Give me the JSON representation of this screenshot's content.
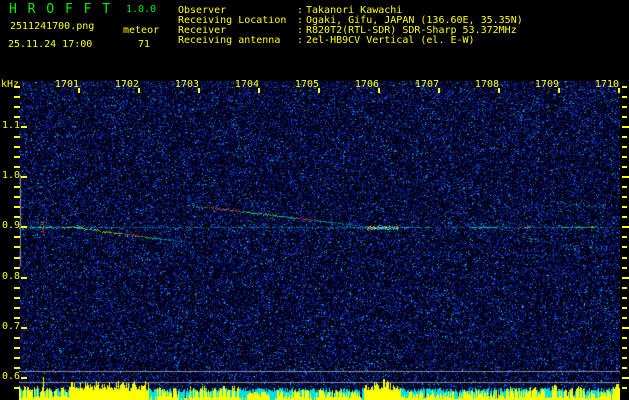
{
  "app": {
    "title": "H R O F F T",
    "version": "1.0.0",
    "filename": "2511241700.png",
    "mode": "meteor",
    "timestamp": "25.11.24 17:00",
    "echo_count": "71"
  },
  "station": {
    "colon": ":",
    "rows": [
      {
        "label": "Observer",
        "value": "Takanori Kawachi"
      },
      {
        "label": "Receiving Location",
        "value": "Ogaki, Gifu, JAPAN (136.60E, 35.35N)"
      },
      {
        "label": "Receiver",
        "value": "R820T2(RTL-SDR) SDR-Sharp 53.372MHz"
      },
      {
        "label": "Receiving antenna",
        "value": "2el-HB9CV Vertical (el. E-W)"
      }
    ]
  },
  "colors": {
    "text_yellow": "#ffff00",
    "text_green": "#00ee00",
    "noise_blue": "#2233cc",
    "carrier_cyan": "#00c8ff",
    "strong_echo_red": "#ff2400",
    "signal_bar_yellow": "#ffff00",
    "signal_floor_cyan": "#00e0e0",
    "marker_gray": "#a8a8b8"
  },
  "chart_data": {
    "type": "heatmap",
    "subtype": "radio-meteor-spectrogram",
    "freq_axis": {
      "unit": "kHz",
      "tick_labels": [
        "1.1",
        "1.0",
        "0.9",
        "0.8",
        "0.7",
        "0.6"
      ],
      "minor_step_khz": 0.02,
      "range_khz": [
        0.58,
        1.19
      ]
    },
    "time_axis": {
      "tick_labels": [
        "1701",
        "1702",
        "1703",
        "1704",
        "1705",
        "1706",
        "1707",
        "1708",
        "1709",
        "1710"
      ],
      "start_hhmm": "17:00",
      "span_minutes": 10
    },
    "carrier_freq_khz": 0.9,
    "echoes": [
      {
        "kind": "carrier",
        "f": 0.9
      },
      {
        "kind": "segment",
        "f": 0.9,
        "t0": 0.0,
        "t1": 1.05,
        "palette": [
          "#22ff88",
          "#aaff22",
          "#00ffcc",
          "#55ff44"
        ]
      },
      {
        "kind": "ping",
        "t": 0.4,
        "f0": 0.888,
        "f1": 0.913,
        "color": "#ff2418"
      },
      {
        "kind": "drift",
        "t0": 0.0,
        "f0": 0.912,
        "t1": 0.55,
        "f1": 0.9025,
        "palette": [
          "#0099cc",
          "#00bbdd"
        ],
        "faint": true
      },
      {
        "kind": "drift",
        "t0": 0.95,
        "f0": 0.9,
        "t1": 2.77,
        "f1": 0.871,
        "palette": [
          "#66ff44",
          "#ccff22",
          "#ffcc00",
          "#ff4400",
          "#44ff66",
          "#00ddcc",
          "#0099cc"
        ]
      },
      {
        "kind": "drift",
        "t0": 2.8,
        "f0": 0.9455,
        "t1": 5.82,
        "f1": 0.9015,
        "palette": [
          "#00ccdd",
          "#ff3322",
          "#ff5500",
          "#33ff66",
          "#99ff33",
          "#22ddaa",
          "#ff4433",
          "#00ccbb",
          "#00bbdd",
          "#00aadd"
        ]
      },
      {
        "kind": "burst",
        "f": 0.9,
        "t0": 5.8,
        "t1": 6.32
      },
      {
        "kind": "segment",
        "f": 0.9,
        "t0": 7.5,
        "t1": 7.95,
        "palette": [
          "#00eeff",
          "#00ccff",
          "#00ddee"
        ]
      },
      {
        "kind": "segment",
        "f": 0.9,
        "t0": 8.42,
        "t1": 8.52,
        "palette": [
          "#ff4433",
          "#ffaa00"
        ]
      },
      {
        "kind": "segment",
        "f": 0.9,
        "t0": 9.05,
        "t1": 9.6,
        "palette": [
          "#22ff77",
          "#66ff33",
          "#00ffbb"
        ]
      },
      {
        "kind": "drift",
        "t0": 8.35,
        "f0": 0.8825,
        "t1": 9.1,
        "f1": 0.866,
        "palette": [
          "#00bbdd",
          "#0099bb"
        ],
        "faint": true
      },
      {
        "kind": "drift",
        "t0": 8.8,
        "f0": 0.954,
        "t1": 9.75,
        "f1": 0.94,
        "palette": [
          "#00bbdd",
          "#00ddee"
        ],
        "faint": true
      }
    ],
    "markers": [
      {
        "kind": "vline",
        "t_min": 0.02,
        "f_from_khz": 1.005,
        "f_to_khz": 0.824
      },
      {
        "kind": "hline",
        "f_khz": 0.6135
      },
      {
        "kind": "hline",
        "f_khz": 0.5915
      }
    ],
    "signal_activity": {
      "regions": [
        [
          0.0,
          0.85,
          0.8
        ],
        [
          0.85,
          2.15,
          0.95
        ],
        [
          2.3,
          2.65,
          0.7
        ],
        [
          2.85,
          3.65,
          0.85
        ],
        [
          3.8,
          4.1,
          0.4
        ],
        [
          4.3,
          4.85,
          0.55
        ],
        [
          4.95,
          5.65,
          0.6
        ],
        [
          5.75,
          6.35,
          1.0
        ],
        [
          6.5,
          7.3,
          0.45
        ],
        [
          7.4,
          8.05,
          0.55
        ],
        [
          8.1,
          8.65,
          0.75
        ],
        [
          8.7,
          9.45,
          0.85
        ],
        [
          9.5,
          9.85,
          0.5
        ],
        [
          9.9,
          10.0,
          0.9
        ]
      ],
      "spikes": [
        [
          0.4,
          23
        ],
        [
          1.9,
          17
        ],
        [
          3.05,
          14
        ],
        [
          5.95,
          18
        ],
        [
          6.08,
          21
        ],
        [
          8.92,
          15
        ],
        [
          9.97,
          16
        ]
      ]
    }
  }
}
